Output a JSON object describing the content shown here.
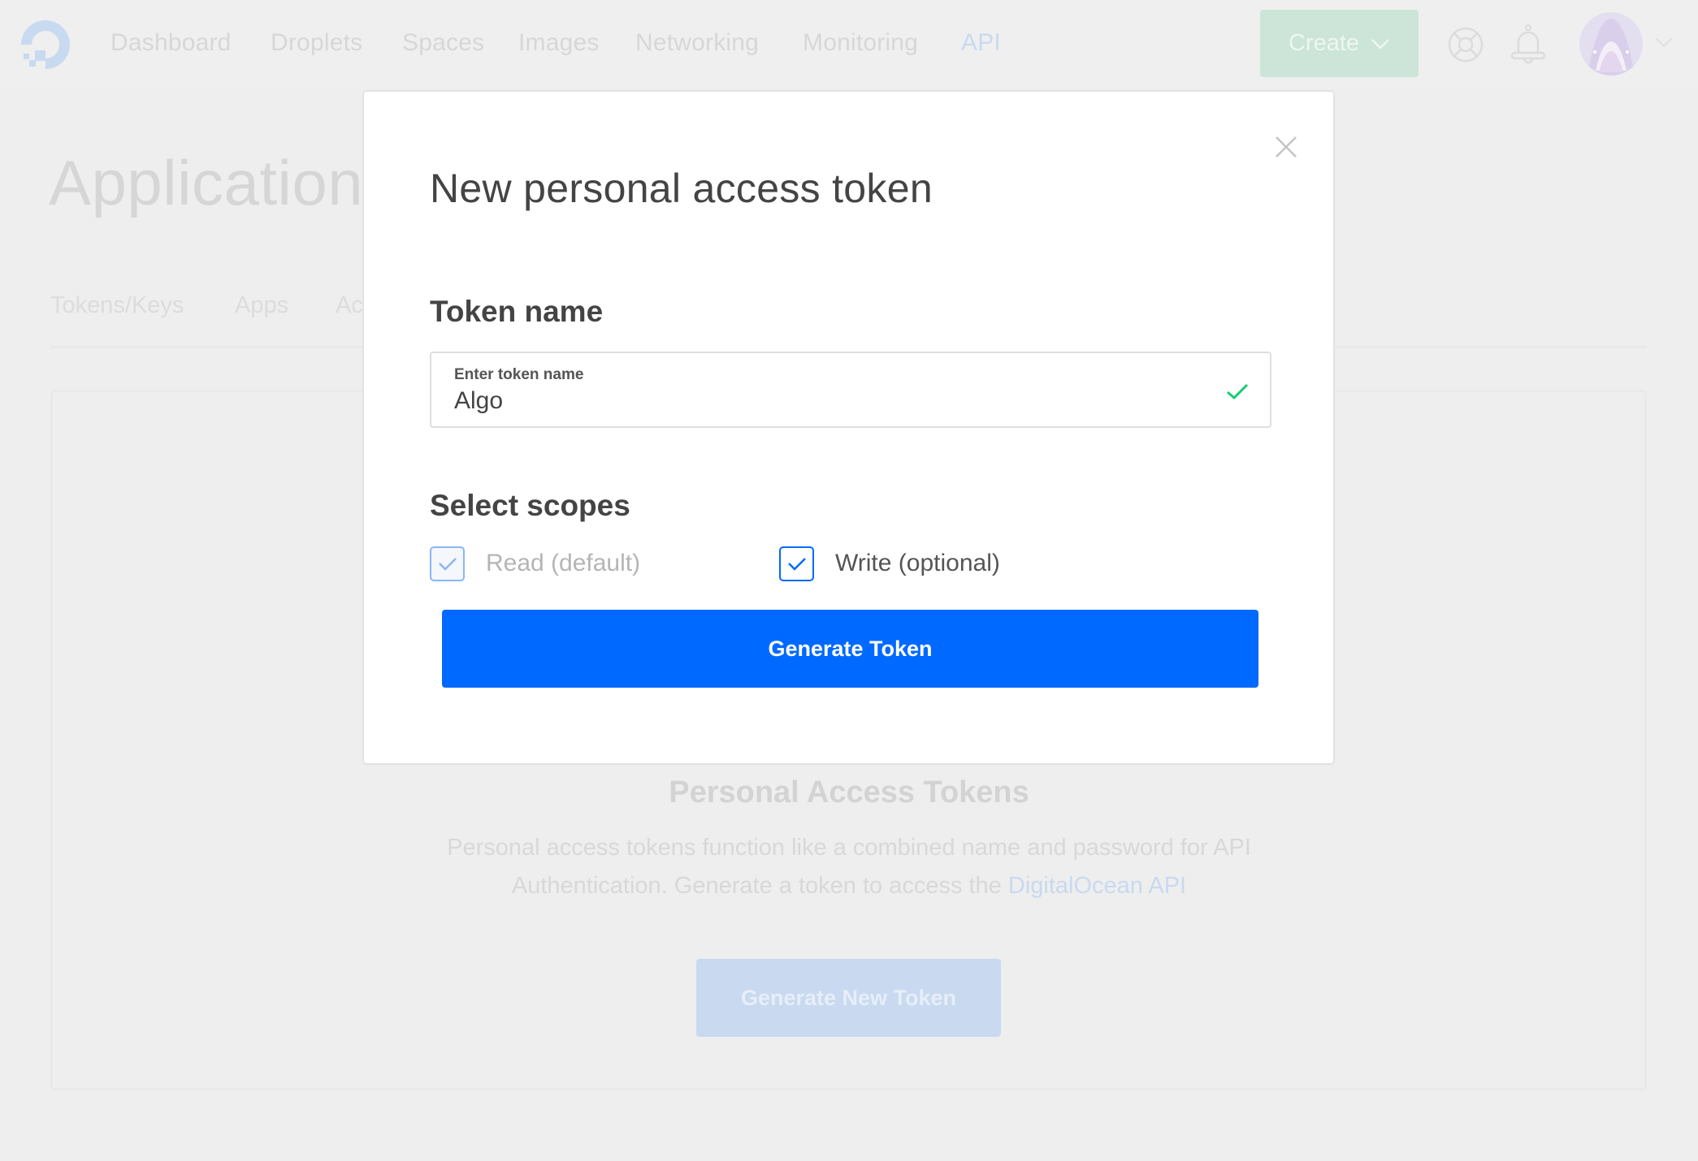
{
  "nav": {
    "items": [
      {
        "label": "Dashboard",
        "active": false
      },
      {
        "label": "Droplets",
        "active": false
      },
      {
        "label": "Spaces",
        "active": false
      },
      {
        "label": "Images",
        "active": false
      },
      {
        "label": "Networking",
        "active": false
      },
      {
        "label": "Monitoring",
        "active": false
      },
      {
        "label": "API",
        "active": true
      }
    ],
    "create_label": "Create",
    "icons": {
      "logo": "digitalocean-logo-icon",
      "support": "lifebuoy-icon",
      "notifications": "bell-icon",
      "avatar": "shark-avatar",
      "account_menu": "chevron-down-icon"
    }
  },
  "page": {
    "title": "Applications",
    "tabs": [
      "Tokens/Keys",
      "Apps",
      "Ac"
    ]
  },
  "card": {
    "heading": "Personal Access Tokens",
    "text_line1": "Personal access tokens function like a combined name and password for API",
    "text_line2": "Authentication. Generate a token to access the ",
    "link": "DigitalOcean API",
    "button": "Generate New Token"
  },
  "modal": {
    "title": "New personal access token",
    "token_name_label": "Token name",
    "input": {
      "label": "Enter token name",
      "value": "Algo",
      "valid": true
    },
    "scopes_label": "Select scopes",
    "scopes": [
      {
        "label": "Read (default)",
        "checked": true,
        "disabled": true
      },
      {
        "label": "Write (optional)",
        "checked": true,
        "disabled": false
      }
    ],
    "submit": "Generate Token"
  },
  "colors": {
    "primary": "#0069ff",
    "success": "#15cd72",
    "text_dark": "#444444",
    "overlay_bg": "#eeeeee"
  }
}
